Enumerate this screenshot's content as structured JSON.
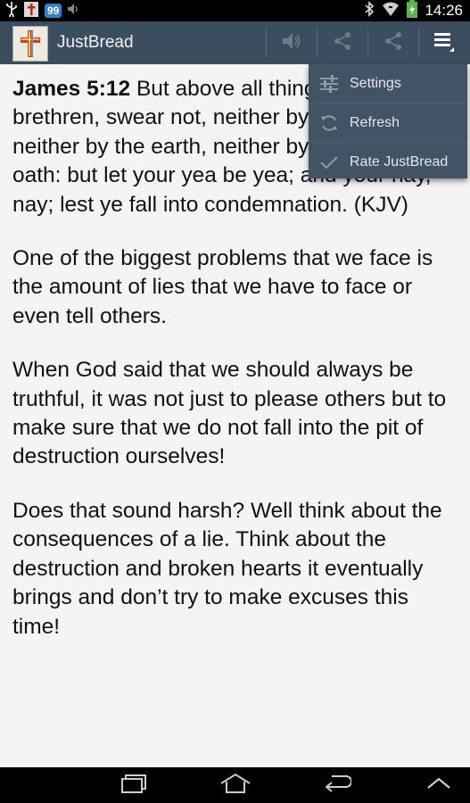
{
  "status_bar": {
    "notification_badge": "99",
    "time": "14:26",
    "icons": [
      "usb-icon",
      "church-icon",
      "message-badge-icon",
      "volume-icon",
      "bluetooth-icon",
      "wifi-icon",
      "battery-icon"
    ]
  },
  "action_bar": {
    "app_name": "JustBread",
    "actions": [
      "speaker-icon",
      "share-icon",
      "share-icon",
      "overflow-menu-icon"
    ]
  },
  "content": {
    "verse_ref": "James 5:12",
    "verse_text": " But above all things, my brethren, swear not, neither by heaven, neither by the earth, neither by any other oath: but let your yea be yea; and your nay, nay; lest ye fall into condemnation. (KJV)",
    "paragraphs": [
      "One of the biggest problems that we face is the amount of lies that we have to face or even tell others.",
      "When God said that we should always be truthful, it was not just to please others but to make sure that we do not fall into the pit of destruction ourselves!",
      "Does that sound harsh? Well think about the consequences of a lie. Think about the destruction and broken hearts it eventually brings and don’t try to make excuses this time!"
    ]
  },
  "menu": {
    "items": [
      {
        "label": "Settings",
        "icon": "sliders-icon"
      },
      {
        "label": "Refresh",
        "icon": "refresh-icon"
      },
      {
        "label": "Rate JustBread",
        "icon": "checkmark-icon"
      }
    ]
  },
  "nav_bar": {
    "buttons": [
      "recent-apps-icon",
      "home-icon",
      "back-icon",
      "hide-keyboard-icon"
    ]
  },
  "colors": {
    "action_bar": "#3b4e5f",
    "menu": "#415466",
    "background": "#f4f4f4"
  }
}
